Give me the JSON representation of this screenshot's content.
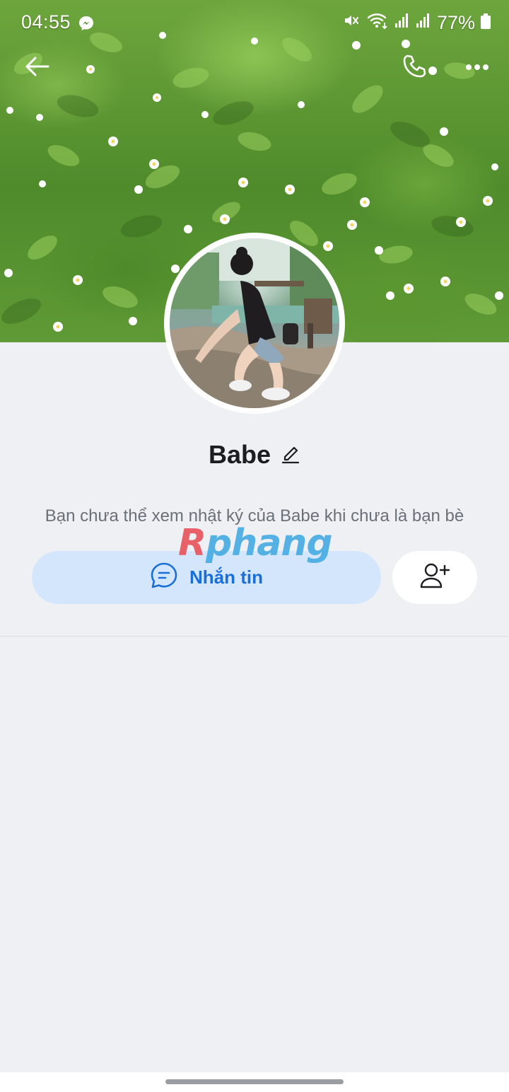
{
  "status_bar": {
    "time": "04:55",
    "battery": "77%",
    "icons": [
      "messenger-icon",
      "mute-icon",
      "wifi-icon",
      "signal-icon",
      "signal-icon",
      "battery-icon"
    ]
  },
  "top_nav": {
    "icons": [
      "back-arrow-icon",
      "phone-icon",
      "more-icon"
    ]
  },
  "profile": {
    "name": "Babe",
    "diary_note": "Bạn chưa thể xem nhật ký của Babe khi chưa là bạn bè"
  },
  "actions": {
    "message_label": "Nhắn tin",
    "message_icon": "chat-bubble-icon",
    "add_friend_icon": "add-friend-icon"
  },
  "watermark": {
    "first": "R",
    "rest": "phang"
  },
  "colors": {
    "accent": "#1a6ed8",
    "message_button_bg": "#d4e6fc",
    "page_bg": "#eef0f4"
  }
}
